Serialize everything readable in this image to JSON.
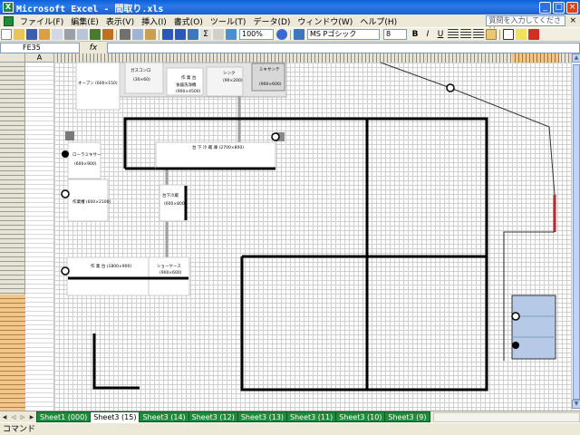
{
  "window": {
    "title": "Microsoft Excel - 間取り.xls",
    "app_icon": "X"
  },
  "menu": {
    "items": [
      "ファイル(F)",
      "編集(E)",
      "表示(V)",
      "挿入(I)",
      "書式(O)",
      "ツール(T)",
      "データ(D)",
      "ウィンドウ(W)",
      "ヘルプ(H)"
    ],
    "help_placeholder": "質問を入力してください"
  },
  "toolbar": {
    "zoom": "100%",
    "font": "MS Pゴシック",
    "size": "8",
    "bold": "B",
    "italic": "I",
    "underline": "U"
  },
  "formula": {
    "cell_ref": "FE35",
    "fx": "fx",
    "value": ""
  },
  "columns": {
    "a": "A"
  },
  "plan_labels": {
    "oven": "オーブン (600×150)",
    "gas_range": "ガスコンロ",
    "gas_range_dim": "(30×60)",
    "counter_top": "作 業 台",
    "dishwasher": "食器洗浄機",
    "counter_dim": "(900×4500)",
    "sink": "シンク",
    "sink_dim": "(90×200)",
    "machine": "ミキサンテ",
    "machine_dim": "(900×600)",
    "mixer": "ローラミキサー",
    "mixer_dim": "(600×900)",
    "prep_sink": "作業槽 (600×2100)",
    "under_sink_long": "台 下 冷 蔵 庫 (2700×800)",
    "under_sink": "台下冷蔵",
    "under_sink_dim": "(600×800)",
    "work_table": "作 業 台 (1800×900)",
    "showcase": "ショーケース",
    "showcase_dim": "(900×600)"
  },
  "sheet_tabs": [
    "Sheet1 (000)",
    "Sheet3 (15)",
    "Sheet3 (14)",
    "Sheet3 (12)",
    "Sheet3 (13)",
    "Sheet3 (11)",
    "Sheet3 (10)",
    "Sheet3 (9)"
  ],
  "active_tab_index": 1,
  "status": {
    "mode": "コマンド"
  },
  "colors": {
    "brand_green": "#1e8a3a",
    "titlebar_blue": "#0a5fd8",
    "selection_orange": "#f2c58a",
    "accent_red": "#c0272d",
    "box_blue": "#b6c9e6"
  }
}
